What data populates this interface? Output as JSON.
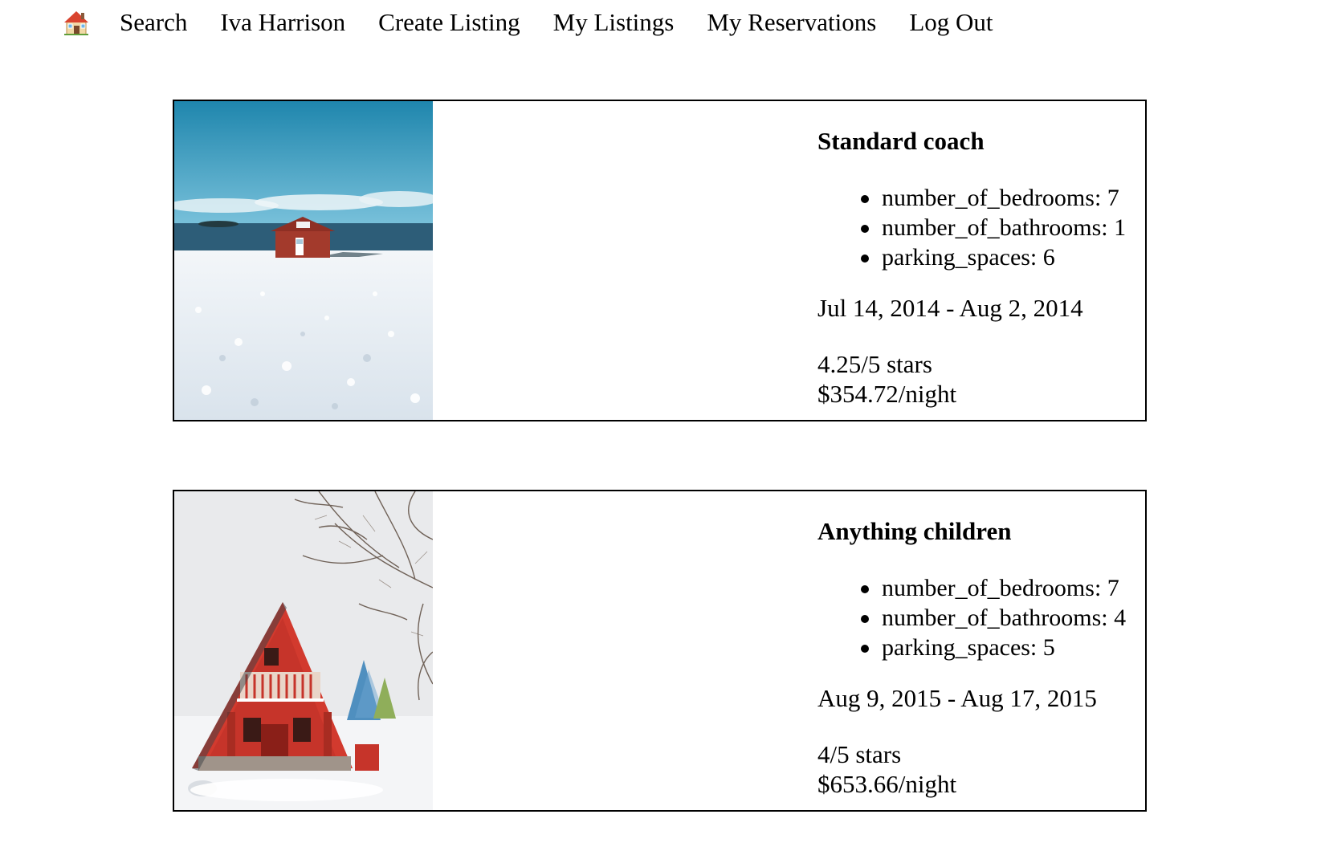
{
  "nav": {
    "logo_icon": "house-icon",
    "items": [
      {
        "label": "Search"
      },
      {
        "label": "Iva Harrison"
      },
      {
        "label": "Create Listing"
      },
      {
        "label": "My Listings"
      },
      {
        "label": "My Reservations"
      },
      {
        "label": "Log Out"
      }
    ]
  },
  "reservations": [
    {
      "title": "Standard coach",
      "image": "red-cabin-by-sea-in-snow-photo",
      "features": [
        "number_of_bedrooms: 7",
        "number_of_bathrooms: 1",
        "parking_spaces: 6"
      ],
      "dates": "Jul 14, 2014 - Aug 2, 2014",
      "rating": "4.25/5 stars",
      "price": "$354.72/night"
    },
    {
      "title": "Anything children",
      "image": "red-a-frame-cabins-in-snow-photo",
      "features": [
        "number_of_bedrooms: 7",
        "number_of_bathrooms: 4",
        "parking_spaces: 5"
      ],
      "dates": "Aug 9, 2015 - Aug 17, 2015",
      "rating": "4/5 stars",
      "price": "$653.66/night"
    }
  ]
}
